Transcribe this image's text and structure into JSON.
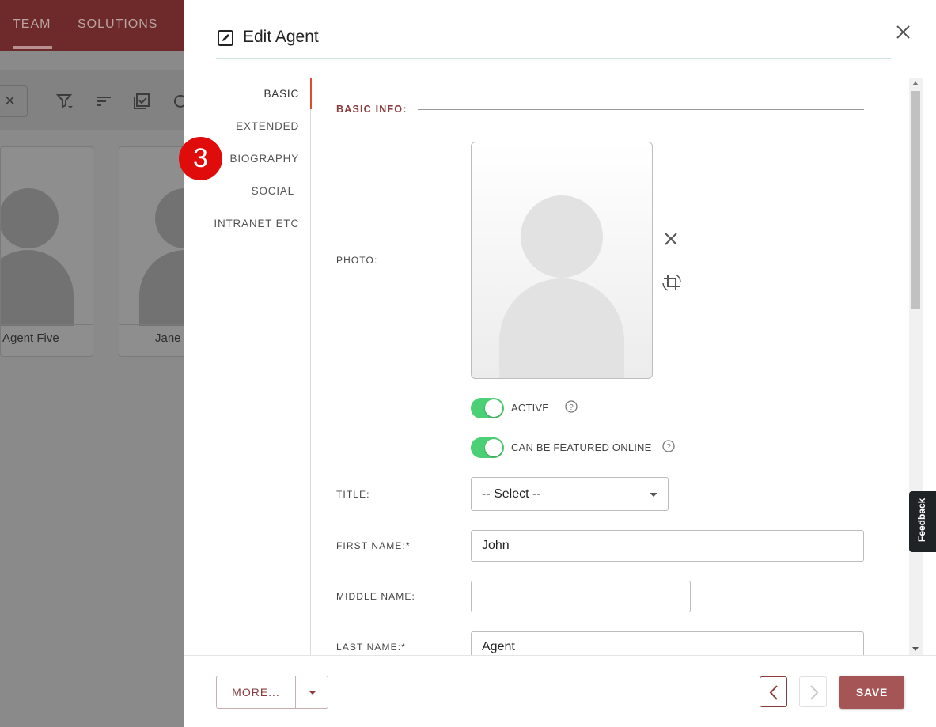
{
  "background": {
    "tabs": [
      "TEAM",
      "SOLUTIONS"
    ],
    "cards": [
      {
        "name": "Agent Five"
      },
      {
        "name": "Jane A"
      }
    ]
  },
  "dialog": {
    "title": "Edit Agent",
    "nav": [
      "BASIC",
      "EXTENDED",
      "BIOGRAPHY",
      "SOCIAL",
      "INTRANET ETC"
    ],
    "active_nav": "BASIC",
    "step_badge": "3",
    "section_title": "BASIC INFO:",
    "photo_label": "PHOTO:",
    "toggles": [
      {
        "label": "ACTIVE",
        "on": true
      },
      {
        "label": "CAN BE FEATURED ONLINE",
        "on": true
      }
    ],
    "title_field": {
      "label": "TITLE:",
      "value": "-- Select --"
    },
    "first_name": {
      "label": "FIRST NAME:*",
      "value": "John"
    },
    "middle_name": {
      "label": "MIDDLE NAME:",
      "value": ""
    },
    "last_name": {
      "label": "LAST NAME:*",
      "value": "Agent"
    }
  },
  "footer": {
    "more_label": "MORE...",
    "save_label": "SAVE"
  },
  "feedback_label": "Feedback",
  "colors": {
    "brand": "#a55555",
    "accent_nav": "#e04a2e",
    "toggle_on": "#4cd075",
    "badge": "#e00b0b"
  }
}
